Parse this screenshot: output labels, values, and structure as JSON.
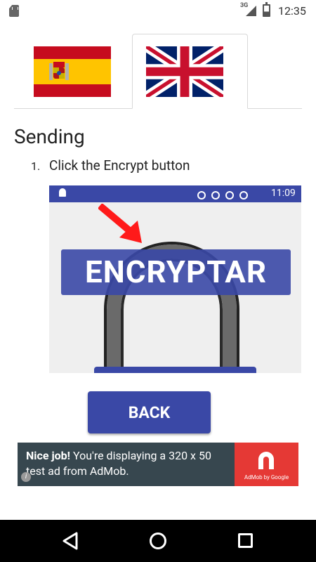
{
  "status_bar": {
    "time": "12:35",
    "network": "3G",
    "icons": [
      "sd-card-icon",
      "signal-icon",
      "battery-icon"
    ]
  },
  "language_tabs": [
    {
      "name": "Spanish",
      "icon": "spain-flag-icon",
      "selected": false
    },
    {
      "name": "English",
      "icon": "uk-flag-icon",
      "selected": true
    }
  ],
  "section": {
    "title": "Sending",
    "steps": [
      {
        "number": "1.",
        "text": "Click the Encrypt button"
      }
    ]
  },
  "example_screenshot": {
    "time": "11:09",
    "button_label": "ENCRYPTAR",
    "icons": [
      "android-icon",
      "block-icon",
      "alarm-icon",
      "wifi-icon",
      "battery-charging-icon"
    ]
  },
  "back_button": {
    "label": "BACK"
  },
  "ad": {
    "headline": "Nice job!",
    "body": " You're displaying a 320 x 50 test ad from AdMob.",
    "brand": "AdMob by Google"
  },
  "colors": {
    "primary": "#3a48a6",
    "ad_background": "#37474f",
    "ad_logo": "#e53935",
    "navbar": "#000000"
  }
}
